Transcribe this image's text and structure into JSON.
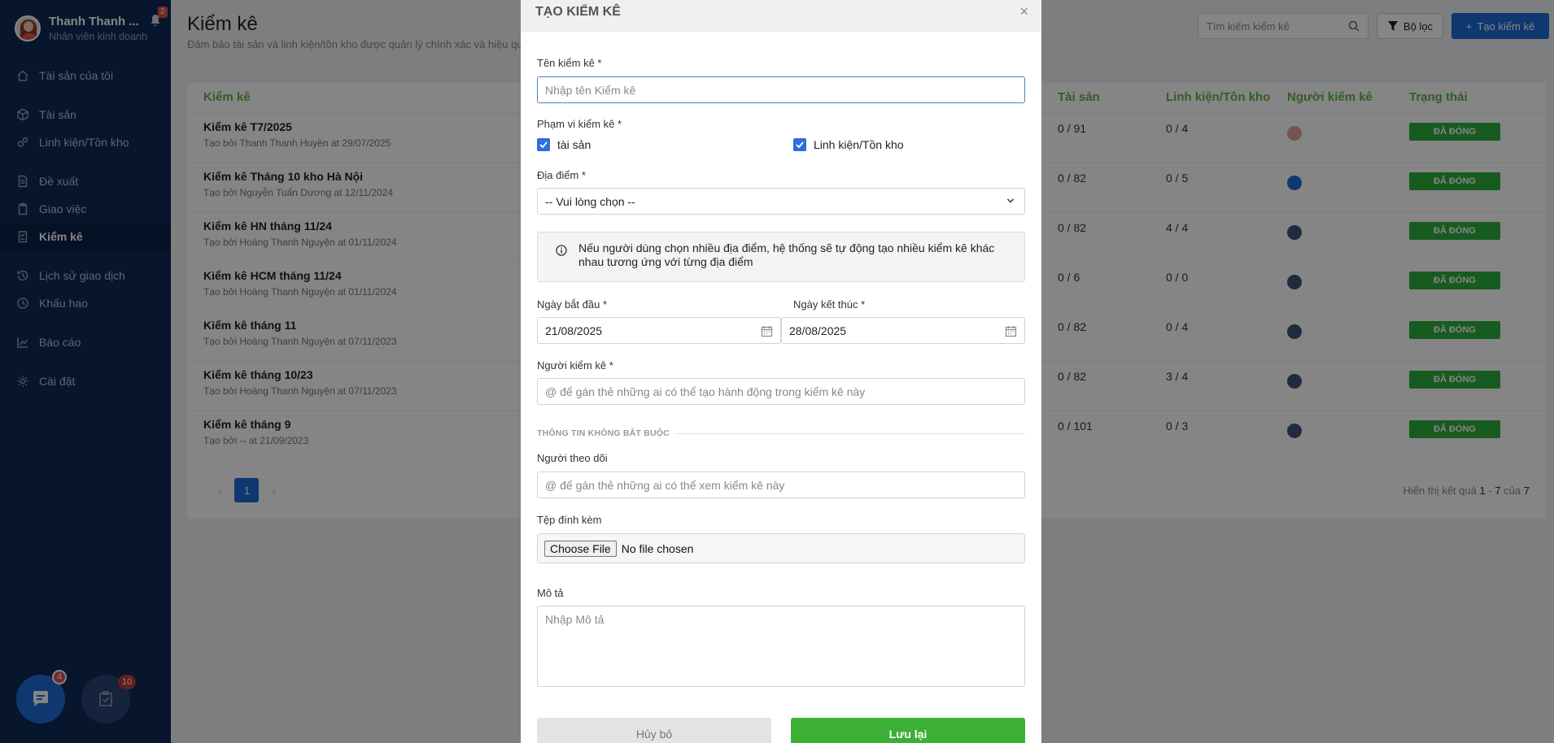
{
  "user": {
    "name": "Thanh Thanh ...",
    "role": "Nhân viên kinh doanh",
    "notifications": "2"
  },
  "sidebar": {
    "items": [
      {
        "label": "Tài sản của tôi",
        "icon": "home-icon"
      },
      {
        "label": "Tài sản",
        "icon": "cube-icon"
      },
      {
        "label": "Linh kiện/Tồn kho",
        "icon": "gears-icon"
      },
      {
        "label": "Đề xuất",
        "icon": "document-icon"
      },
      {
        "label": "Giao việc",
        "icon": "clipboard-icon"
      },
      {
        "label": "Kiểm kê",
        "icon": "checklist-icon"
      },
      {
        "label": "Lịch sử giao dịch",
        "icon": "history-icon"
      },
      {
        "label": "Khấu hao",
        "icon": "clock-icon"
      },
      {
        "label": "Báo cáo",
        "icon": "chart-icon"
      },
      {
        "label": "Cài đặt",
        "icon": "gear-icon"
      }
    ],
    "chat_badge": "4",
    "task_badge": "10"
  },
  "header": {
    "title": "Kiểm kê",
    "subtitle": "Đảm bảo tài sản và linh kiện/tồn kho được quản lý chính xác và hiệu quả",
    "search_placeholder": "Tìm kiếm kiểm kê",
    "filter_label": "Bộ lọc",
    "create_label": "Tạo kiểm kê"
  },
  "table": {
    "columns": {
      "name": "Kiểm kê",
      "assets": "Tài sản",
      "parts": "Linh kiện/Tồn kho",
      "auditor": "Người kiểm kê",
      "status": "Trạng thái"
    },
    "rows": [
      {
        "name": "Kiểm kê T7/2025",
        "by": "Tạo bởi Thanh Thanh Huyền at 29/07/2025",
        "assets": "0 / 91",
        "parts": "0 / 4",
        "status": "ĐÃ ĐÓNG"
      },
      {
        "name": "Kiểm kê Tháng 10 kho Hà Nội",
        "by": "Tạo bởi Nguyễn Tuấn Dương at 12/11/2024",
        "assets": "0 / 82",
        "parts": "0 / 5",
        "status": "ĐÃ ĐÓNG"
      },
      {
        "name": "Kiểm kê HN tháng 11/24",
        "by": "Tạo bởi Hoàng Thanh Nguyện at 01/11/2024",
        "assets": "0 / 82",
        "parts": "4 / 4",
        "status": "ĐÃ ĐÓNG"
      },
      {
        "name": "Kiểm kê HCM tháng 11/24",
        "by": "Tạo bởi Hoàng Thanh Nguyện at 01/11/2024",
        "assets": "0 / 6",
        "parts": "0 / 0",
        "status": "ĐÃ ĐÓNG"
      },
      {
        "name": "Kiểm kê tháng 11",
        "by": "Tạo bởi Hoàng Thanh Nguyện at 07/11/2023",
        "assets": "0 / 82",
        "parts": "0 / 4",
        "status": "ĐÃ ĐÓNG"
      },
      {
        "name": "Kiểm kê tháng 10/23",
        "by": "Tạo bởi Hoàng Thanh Nguyện at 07/11/2023",
        "assets": "0 / 82",
        "parts": "3 / 4",
        "status": "ĐÃ ĐÓNG"
      },
      {
        "name": "Kiểm kê tháng 9",
        "by": "Tạo bởi -- at 21/09/2023",
        "assets": "0 / 101",
        "parts": "0 / 3",
        "status": "ĐÃ ĐÓNG"
      }
    ],
    "pagination": {
      "current": "1",
      "info_prefix": "Hiển thị kết quả",
      "from": "1",
      "dash": "-",
      "to": "7",
      "of": "của",
      "total": "7"
    }
  },
  "modal": {
    "title": "TẠO KIỂM KÊ",
    "name_label": "Tên kiểm kê *",
    "name_placeholder": "Nhập tên Kiểm kê",
    "scope_label": "Phạm vi kiểm kê *",
    "scope_assets": "tài sản",
    "scope_parts": "Linh kiện/Tồn kho",
    "location_label": "Địa điểm *",
    "location_value": "-- Vui lòng chọn --",
    "info_text": "Nếu người dùng chọn nhiều địa điểm, hệ thống sẽ tự động tạo nhiều kiểm kê khác nhau tương ứng với từng địa điểm",
    "start_label": "Ngày bắt đầu *",
    "start_value": "21/08/2025",
    "end_label": "Ngày kết thúc *",
    "end_value": "28/08/2025",
    "auditor_label": "Người kiểm kê *",
    "auditor_placeholder": "@ để gán thẻ những ai có thể tạo hành động trong kiểm kê này",
    "optional_title": "THÔNG TIN KHÔNG BẮT BUỘC",
    "follower_label": "Người theo dõi",
    "follower_placeholder": "@ để gán thẻ những ai có thể xem kiểm kê này",
    "attach_label": "Tệp đính kèm",
    "file_button": "Choose File",
    "file_status": "No file chosen",
    "desc_label": "Mô tả",
    "desc_placeholder": "Nhập Mô tả",
    "cancel_label": "Hủy bỏ",
    "save_label": "Lưu lại"
  },
  "colors": {
    "sidebar": "#0f2a57",
    "primary": "#1d6bd6",
    "success": "#2cae3e",
    "header_green": "#5fb446"
  }
}
